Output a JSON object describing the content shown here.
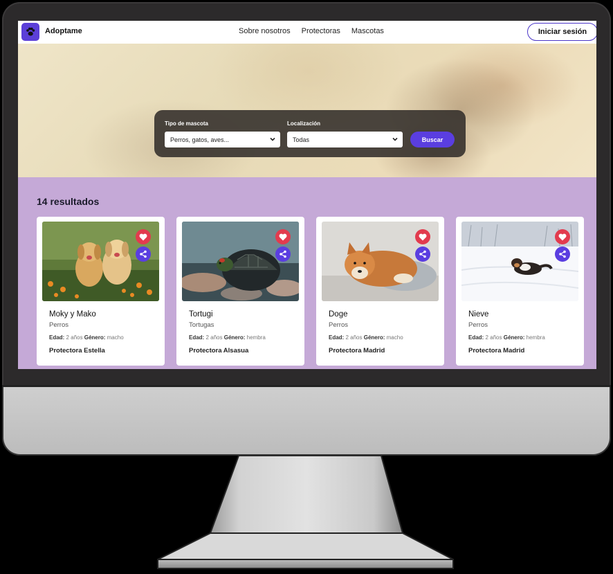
{
  "navbar": {
    "brand": "Adoptame",
    "links": [
      "Sobre nosotros",
      "Protectoras",
      "Mascotas"
    ],
    "login_label": "Iniciar sesión",
    "accent": "#5b3fd8"
  },
  "search": {
    "pet_type_label": "Tipo de mascota",
    "pet_type_value": "Perros, gatos, aves...",
    "location_label": "Localización",
    "location_value": "Todas",
    "search_button": "Buscar"
  },
  "results": {
    "title": "14 resultados",
    "background": "#c5a9d7",
    "age_label": "Edad:",
    "gender_label": "Género:",
    "cards": [
      {
        "name": "Moky y Mako",
        "species": "Perros",
        "age": "2 años",
        "gender": "macho",
        "shelter": "Protectora Estella",
        "image": "two-puppies-photo"
      },
      {
        "name": "Tortugi",
        "species": "Tortugas",
        "age": "2 años",
        "gender": "hembra",
        "shelter": "Protectora Alsasua",
        "image": "turtle-photo"
      },
      {
        "name": "Doge",
        "species": "Perros",
        "age": "2 años",
        "gender": "macho",
        "shelter": "Protectora Madrid",
        "image": "shiba-photo"
      },
      {
        "name": "Nieve",
        "species": "Perros",
        "age": "2 años",
        "gender": "hembra",
        "shelter": "Protectora Madrid",
        "image": "dog-in-snow-photo"
      }
    ]
  },
  "icons": {
    "logo": "paw-icon",
    "favorite": "heart-icon",
    "share": "share-icon",
    "select": "chevron-down-icon"
  }
}
